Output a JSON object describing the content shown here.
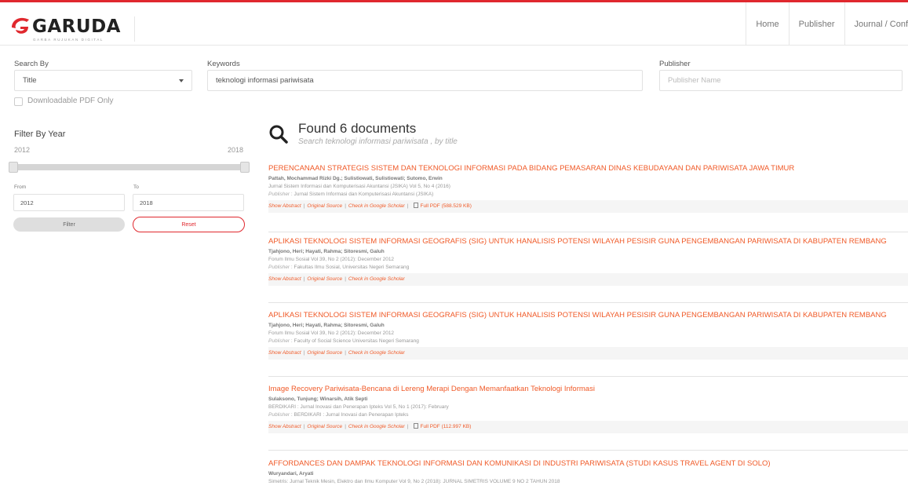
{
  "header": {
    "brand_name": "GARUDA",
    "brand_tagline": "GARBA RUJUKAN DIGITAL",
    "brand_color": "#e0282e",
    "nav": [
      "Home",
      "Publisher",
      "Journal / Conf"
    ]
  },
  "search": {
    "search_by_label": "Search By",
    "search_by_value": "Title",
    "keywords_label": "Keywords",
    "keywords_value": "teknologi informasi pariwisata",
    "publisher_label": "Publisher",
    "publisher_placeholder": "Publisher Name",
    "pdf_only_label": "Downloadable PDF Only"
  },
  "filter": {
    "title": "Filter By Year",
    "range_min": "2012",
    "range_max": "2018",
    "from_label": "From",
    "to_label": "To",
    "from_value": "2012",
    "to_value": "2018",
    "filter_button": "Filter",
    "reset_button": "Reset"
  },
  "results_header": {
    "title": "Found 6 documents",
    "subtitle": "Search  teknologi informasi pariwisata ,  by title"
  },
  "links": {
    "show_abstract": "Show Abstract",
    "original_source": "Original Source",
    "check_scholar": "Check in Google Scholar",
    "separator": "|"
  },
  "results": [
    {
      "title": "PERENCANAAN STRATEGIS SISTEM DAN TEKNOLOGI INFORMASI PADA BIDANG PEMASARAN DINAS KEBUDAYAAN DAN PARIWISATA JAWA TIMUR",
      "authors": "Pattah, Mochammad Rizki Dg.; Sulistiowati, Sulistiowati; Sutomo, Erwin",
      "source": "Jurnal Sistem Informasi dan Komputerisasi Akuntansi (JSIKA)  Vol 5, No 4 (2016)",
      "publisher_prefix": "Publisher",
      "publisher": " : Jurnal Sistem Informasi dan Komputerisasi Akuntansi (JSIKA)",
      "pdf": "Full PDF (588.529 KB)"
    },
    {
      "title": "APLIKASI TEKNOLOGI SISTEM INFORMASI GEOGRAFIS (SIG) UNTUK HANALISIS POTENSI WILAYAH PESISIR GUNA PENGEMBANGAN PARIWISATA DI KABUPATEN REMBANG",
      "authors": "Tjahjono, Heri; Hayati, Rahma; Sitoresmi, Galuh",
      "source": "Forum Ilmu Sosial  Vol 39, No 2 (2012): December 2012",
      "publisher_prefix": "Publisher",
      "publisher": " : Fakultas Ilmu Sosial, Universitas Negeri Semarang",
      "pdf": ""
    },
    {
      "title": "APLIKASI TEKNOLOGI SISTEM INFORMASI GEOGRAFIS (SIG) UNTUK HANALISIS POTENSI WILAYAH PESISIR GUNA PENGEMBANGAN PARIWISATA DI KABUPATEN REMBANG",
      "authors": "Tjahjono, Heri; Hayati, Rahma; Sitoresmi, Galuh",
      "source": "Forum Ilmu Sosial  Vol 39, No 2 (2012): December 2012",
      "publisher_prefix": "Publisher",
      "publisher": " : Faculty of Social Science Universitas Negeri Semarang",
      "pdf": ""
    },
    {
      "title": "Image Recovery Pariwisata-Bencana di Lereng Merapi Dengan Memanfaatkan Teknologi Informasi",
      "authors": "Sulaksono, Tunjung; Winarsih, Atik Septi",
      "source": "BERDIKARI : Jurnal Inovasi dan Penerapan Ipteks  Vol 5, No 1 (2017): February",
      "publisher_prefix": "Publisher",
      "publisher": " : BERDIKARI : Jurnal Inovasi dan Penerapan Ipteks",
      "pdf": "Full PDF (112.997 KB)"
    },
    {
      "title": "AFFORDANCES DAN DAMPAK TEKNOLOGI INFORMASI DAN KOMUNIKASI DI INDUSTRI PARIWISATA  (STUDI KASUS TRAVEL AGENT DI SOLO)",
      "authors": "Wuryandari, Aryati",
      "source": "Simetris: Jurnal Teknik Mesin, Elektro dan Ilmu Komputer  Vol 9, No 2 (2018): JURNAL SIMETRIS VOLUME 9 NO 2 TAHUN 2018",
      "publisher_prefix": "",
      "publisher": "",
      "pdf": ""
    }
  ]
}
